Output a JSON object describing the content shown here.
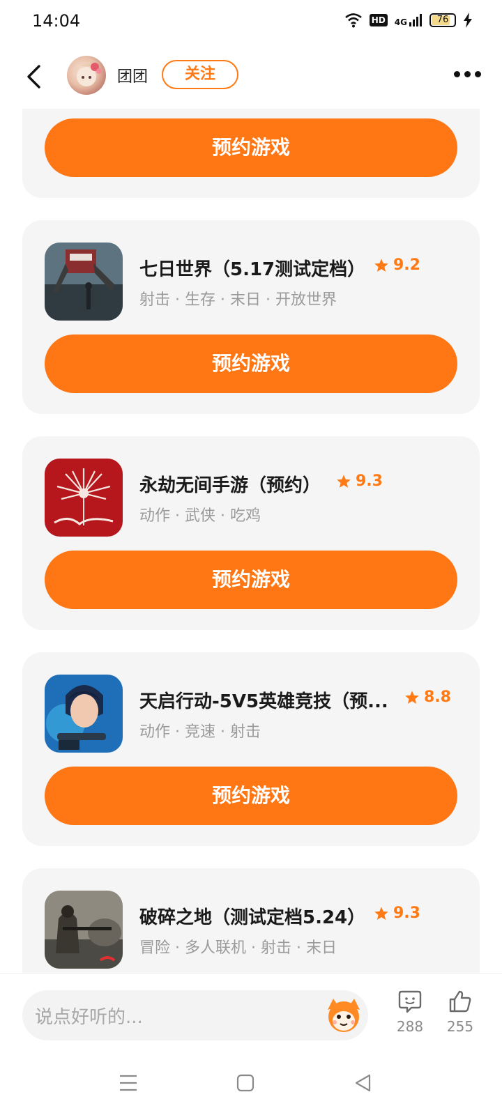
{
  "status_bar": {
    "time": "14:04",
    "hd": "HD",
    "network": "4G",
    "battery": "76"
  },
  "header": {
    "username": "团团",
    "follow_label": "关注"
  },
  "games": [
    {
      "title": "",
      "rating": "",
      "tags": "",
      "button": "预约游戏"
    },
    {
      "title": "七日世界（5.17测试定档）",
      "rating": "9.2",
      "tags": "射击 · 生存 · 末日 · 开放世界",
      "button": "预约游戏"
    },
    {
      "title": "永劫无间手游（预约）",
      "rating": "9.3",
      "tags": "动作 · 武侠 · 吃鸡",
      "button": "预约游戏"
    },
    {
      "title": "天启行动-5V5英雄竞技（预...",
      "rating": "8.8",
      "tags": "动作 · 竞速 · 射击",
      "button": "预约游戏"
    },
    {
      "title": "破碎之地（测试定档5.24）",
      "rating": "9.3",
      "tags": "冒险 · 多人联机 · 射击 · 末日",
      "button": ""
    }
  ],
  "comment_bar": {
    "placeholder": "说点好听的...",
    "comment_count": "288",
    "like_count": "255"
  },
  "colors": {
    "accent": "#ff7614",
    "card_bg": "#f5f5f5"
  }
}
